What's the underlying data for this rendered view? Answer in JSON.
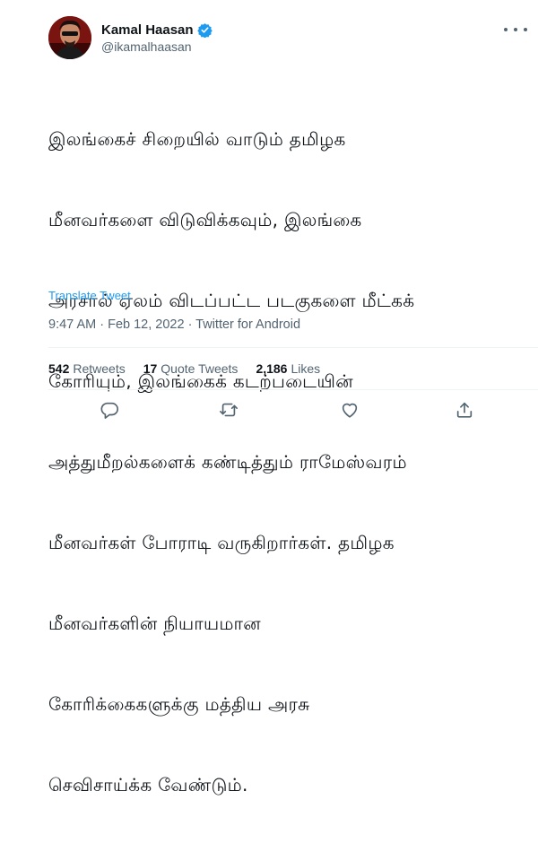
{
  "author": {
    "display_name": "Kamal Haasan",
    "handle": "@ikamalhaasan",
    "verified": true
  },
  "tweet": {
    "text_lines": [
      "இலங்கைச் சிறையில் வாடும் தமிழக",
      "மீனவர்களை விடுவிக்கவும், இலங்கை",
      "அரசால் ஏலம் விடப்பட்ட படகுகளை மீட்கக்",
      "கோரியும், இலங்கைக் கடற்படையின்",
      "அத்துமீறல்களைக் கண்டித்தும் ராமேஸ்வரம்",
      "மீனவர்கள் போராடி வருகிறார்கள். தமிழக",
      "மீனவர்களின் நியாயமான",
      "கோரிக்கைகளுக்கு மத்திய அரசு",
      "செவிசாய்க்க வேண்டும்."
    ],
    "translate_label": "Translate Tweet",
    "timestamp": "9:47 AM · Feb 12, 2022 · Twitter for Android"
  },
  "stats": {
    "retweets_count": "542",
    "retweets_label": "Retweets",
    "quote_count": "17",
    "quote_label": "Quote Tweets",
    "likes_count": "2,186",
    "likes_label": "Likes"
  },
  "icons": {
    "verified": "verified-badge-icon",
    "more": "more-options-icon",
    "reply": "reply-icon",
    "retweet": "retweet-icon",
    "like": "like-icon",
    "share": "share-icon"
  },
  "colors": {
    "accent": "#1d9bf0",
    "secondary_text": "#536471",
    "primary_text": "#0f1419",
    "divider": "#eff3f4"
  }
}
